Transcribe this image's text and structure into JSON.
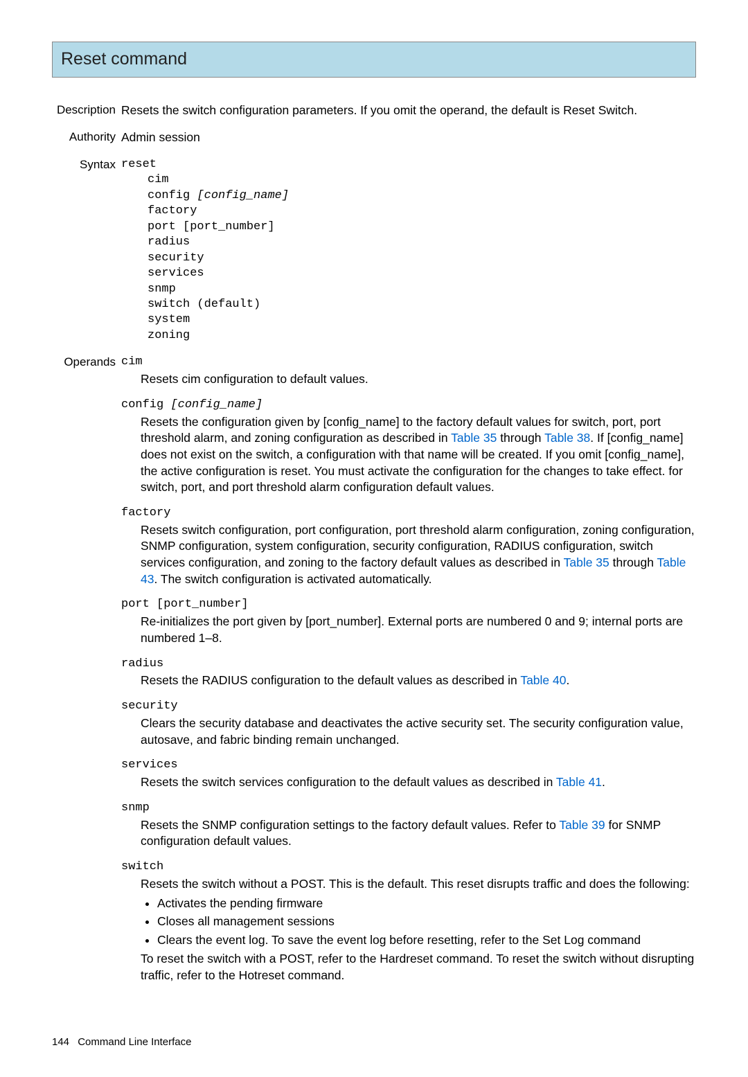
{
  "title": "Reset command",
  "description_label": "Description",
  "description_text": "Resets the switch configuration parameters. If you omit the operand, the default is Reset Switch.",
  "authority_label": "Authority",
  "authority_text": "Admin session",
  "syntax_label": "Syntax",
  "syntax_cmd": "reset",
  "syntax_lines": {
    "l1": "cim",
    "l2a": "config ",
    "l2b": "[config_name]",
    "l3": "factory",
    "l4": "port [port_number]",
    "l5": "radius",
    "l6": "security",
    "l7": "services",
    "l8": "snmp",
    "l9": "switch (default)",
    "l10": "system",
    "l11": "zoning"
  },
  "operands_label": "Operands",
  "op_cim_term": "cim",
  "op_cim_desc": "Resets cim configuration to default values.",
  "op_config_term_a": "config ",
  "op_config_term_b": "[config_name]",
  "op_config_desc_a": "Resets the configuration given by [config_name] to the factory default values for switch, port, port threshold alarm, and zoning configuration as described in ",
  "op_config_link1": "Table 35",
  "op_config_desc_b": " through ",
  "op_config_link2": "Table 38",
  "op_config_desc_c": ". If [config_name] does not exist on the switch, a configuration with that name will be created. If you omit [config_name], the active configuration is reset. You must activate the configuration for the changes to take effect. for switch, port, and port threshold alarm configuration default values.",
  "op_factory_term": "factory",
  "op_factory_desc_a": "Resets switch configuration, port configuration, port threshold alarm configuration, zoning configuration, SNMP configuration, system configuration, security configuration, RADIUS configuration, switch services configuration, and zoning to the factory default values as described in ",
  "op_factory_link1": "Table 35",
  "op_factory_desc_b": " through ",
  "op_factory_link2": "Table 43",
  "op_factory_desc_c": ". The switch configuration is activated automatically.",
  "op_port_term": "port [port_number]",
  "op_port_desc": "Re-initializes the port given by [port_number]. External ports are numbered 0 and 9; internal ports are numbered 1–8.",
  "op_radius_term": "radius",
  "op_radius_desc_a": "Resets the RADIUS configuration to the default values as described in ",
  "op_radius_link1": "Table 40",
  "op_radius_desc_b": ".",
  "op_security_term": "security",
  "op_security_desc": "Clears the security database and deactivates the active security set. The security configuration value, autosave, and fabric binding remain unchanged.",
  "op_services_term": "services",
  "op_services_desc_a": "Resets the switch services configuration to the default values as described in ",
  "op_services_link1": "Table 41",
  "op_services_desc_b": ".",
  "op_snmp_term": "snmp",
  "op_snmp_desc_a": "Resets the SNMP configuration settings to the factory default values. Refer to ",
  "op_snmp_link1": "Table 39",
  "op_snmp_desc_b": " for SNMP configuration default values.",
  "op_switch_term": "switch",
  "op_switch_desc": "Resets the switch without a POST. This is the default. This reset disrupts traffic and does the following:",
  "op_switch_b1": "Activates the pending firmware",
  "op_switch_b2": "Closes all management sessions",
  "op_switch_b3": "Clears the event log. To save the event log before resetting, refer to the Set Log command",
  "op_switch_after": "To reset the switch with a POST, refer to the Hardreset command. To reset the switch without disrupting traffic, refer to the Hotreset command.",
  "footer_page": "144",
  "footer_text": "Command Line Interface"
}
